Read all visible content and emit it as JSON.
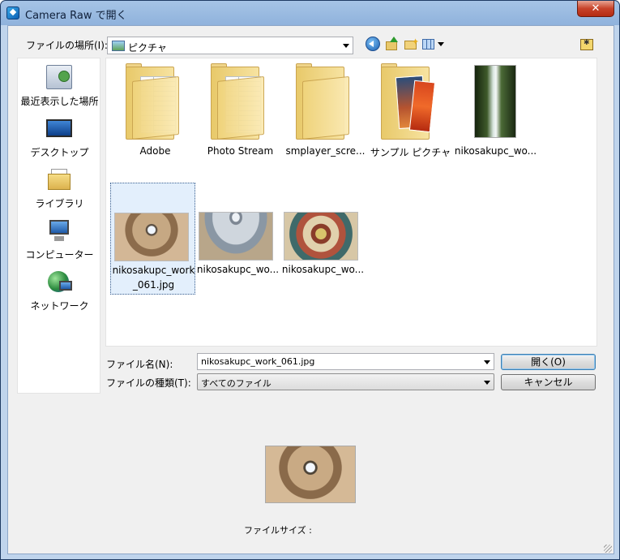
{
  "window": {
    "title": "Camera Raw で開く",
    "close_label": "✕"
  },
  "lookin": {
    "label": "ファイルの場所(I):",
    "value": "ピクチャ"
  },
  "places": [
    {
      "label": "最近表示した場所",
      "icon": "recent-places-icon"
    },
    {
      "label": "デスクトップ",
      "icon": "desktop-icon"
    },
    {
      "label": "ライブラリ",
      "icon": "library-icon"
    },
    {
      "label": "コンピューター",
      "icon": "computer-icon"
    },
    {
      "label": "ネットワーク",
      "icon": "network-icon"
    }
  ],
  "files": [
    {
      "label": "Adobe",
      "kind": "folder"
    },
    {
      "label": "Photo Stream",
      "kind": "folder"
    },
    {
      "label": "smplayer_scre...",
      "kind": "folder"
    },
    {
      "label": "サンプル ピクチャ",
      "kind": "folder-photos"
    },
    {
      "label": "nikosakupc_wo...",
      "kind": "image-tall"
    },
    {
      "label": "nikosakupc_work",
      "label2": "_061.jpg",
      "kind": "image-dome",
      "selected": true
    },
    {
      "label": "nikosakupc_wo...",
      "kind": "image-dome2"
    },
    {
      "label": "nikosakupc_wo...",
      "kind": "image-fresco"
    }
  ],
  "filename": {
    "label": "ファイル名(N):",
    "value": "nikosakupc_work_061.jpg"
  },
  "filetype": {
    "label": "ファイルの種類(T):",
    "value": "すべてのファイル"
  },
  "buttons": {
    "open": "開く(O)",
    "cancel": "キャンセル"
  },
  "preview": {
    "filesize_label": "ファイルサイズ :"
  },
  "colors": {
    "title_bar": "#8fb2dc",
    "selection": "#e3effc",
    "close": "#c7432a"
  }
}
